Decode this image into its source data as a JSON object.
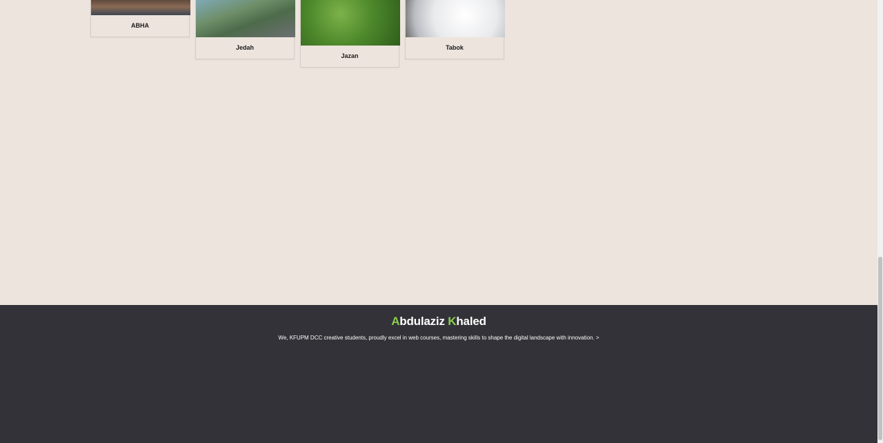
{
  "cards": [
    {
      "label": "ABHA"
    },
    {
      "label": "Jedah"
    },
    {
      "label": "Jazan"
    },
    {
      "label": "Tabok"
    }
  ],
  "footer": {
    "brand_first_initial": "A",
    "brand_first_rest": "bdulaziz",
    "brand_last_initial": "K",
    "brand_last_rest": "haled",
    "tagline": "We, KFUPM DCC creative students, proudly excel in web courses, mastering skills to shape the digital landscape with innovation. >"
  },
  "colors": {
    "page_bg": "#ede4dd",
    "footer_bg": "#323238",
    "accent": "#8ccf4d"
  }
}
